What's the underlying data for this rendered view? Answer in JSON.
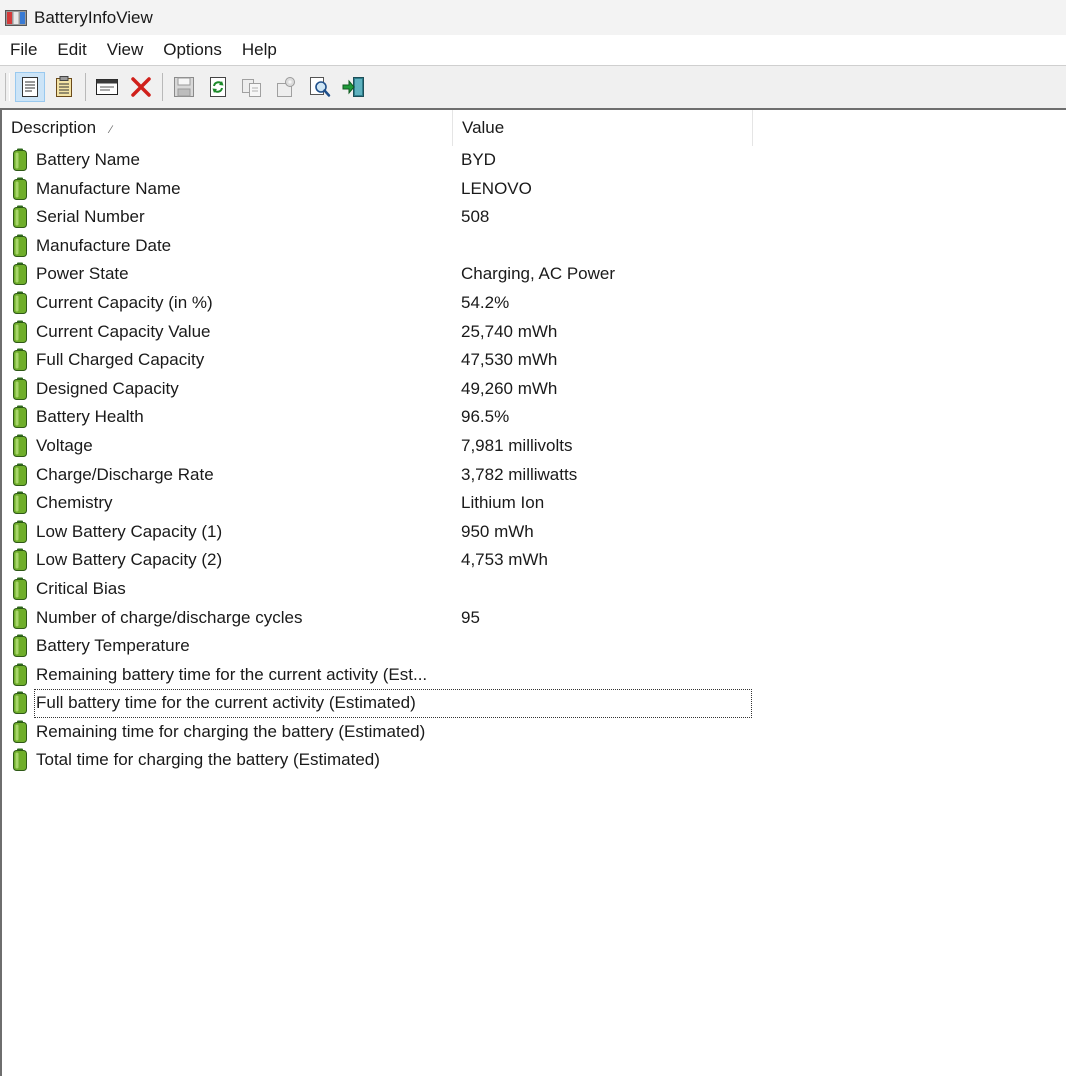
{
  "window": {
    "title": "BatteryInfoView"
  },
  "menu": [
    "File",
    "Edit",
    "View",
    "Options",
    "Help"
  ],
  "toolbar": {
    "buttons": [
      {
        "name": "properties-icon",
        "active": true
      },
      {
        "name": "html-report-icon",
        "active": false
      },
      "separator",
      {
        "name": "window-icon",
        "active": false
      },
      {
        "name": "delete-icon",
        "active": false
      },
      "separator",
      {
        "name": "save-icon",
        "active": false
      },
      {
        "name": "refresh-icon",
        "active": false
      },
      {
        "name": "copy-icon",
        "active": false
      },
      {
        "name": "options-icon",
        "active": false
      },
      {
        "name": "find-icon",
        "active": false
      },
      {
        "name": "exit-icon",
        "active": false
      }
    ]
  },
  "columns": {
    "description": "Description",
    "value": "Value"
  },
  "rows": [
    {
      "description": "Battery Name",
      "value": "BYD"
    },
    {
      "description": "Manufacture Name",
      "value": "LENOVO"
    },
    {
      "description": "Serial Number",
      "value": "508"
    },
    {
      "description": "Manufacture Date",
      "value": ""
    },
    {
      "description": "Power State",
      "value": "Charging, AC Power"
    },
    {
      "description": "Current Capacity (in %)",
      "value": "54.2%"
    },
    {
      "description": "Current Capacity Value",
      "value": "25,740 mWh"
    },
    {
      "description": "Full Charged Capacity",
      "value": "47,530 mWh"
    },
    {
      "description": "Designed Capacity",
      "value": "49,260 mWh"
    },
    {
      "description": "Battery Health",
      "value": "96.5%"
    },
    {
      "description": "Voltage",
      "value": "7,981 millivolts"
    },
    {
      "description": "Charge/Discharge Rate",
      "value": "3,782 milliwatts"
    },
    {
      "description": "Chemistry",
      "value": "Lithium Ion"
    },
    {
      "description": "Low Battery Capacity (1)",
      "value": "950 mWh"
    },
    {
      "description": "Low Battery Capacity (2)",
      "value": "4,753 mWh"
    },
    {
      "description": "Critical Bias",
      "value": ""
    },
    {
      "description": "Number of charge/discharge cycles",
      "value": "95"
    },
    {
      "description": "Battery Temperature",
      "value": ""
    },
    {
      "description": "Remaining battery time for the current activity (Est...",
      "value": ""
    },
    {
      "description": "Full battery time for the current activity (Estimated)",
      "value": "",
      "focused": true
    },
    {
      "description": "Remaining time for charging the battery (Estimated)",
      "value": ""
    },
    {
      "description": "Total  time for charging the battery (Estimated)",
      "value": ""
    }
  ]
}
